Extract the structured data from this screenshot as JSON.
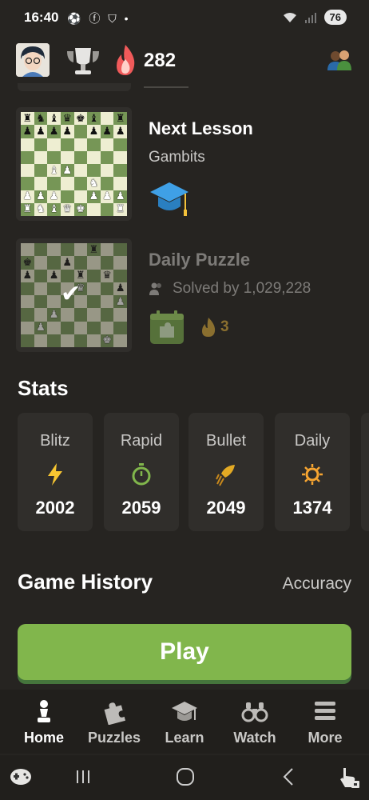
{
  "status_bar": {
    "time": "16:40",
    "icons": "⚽ ⓕ ⛉ •",
    "battery": "76"
  },
  "top_bar": {
    "streak_count": "282",
    "icons": [
      "avatar",
      "trophy-icon",
      "flame-icon",
      "friends-icon"
    ]
  },
  "lesson": {
    "title": "Next Lesson",
    "subtitle": "Gambits",
    "icon": "graduation-cap-icon"
  },
  "puzzle": {
    "title": "Daily Puzzle",
    "solved_text": "Solved by 1,029,228",
    "streak": "3",
    "icons": [
      "people-icon",
      "puzzle-calendar-icon",
      "flame-icon"
    ]
  },
  "stats": {
    "title": "Stats",
    "cards": [
      {
        "name": "Blitz",
        "value": "2002",
        "icon": "lightning-icon",
        "color": "#f7c631"
      },
      {
        "name": "Rapid",
        "value": "2059",
        "icon": "stopwatch-icon",
        "color": "#81b64c"
      },
      {
        "name": "Bullet",
        "value": "2049",
        "icon": "rocket-icon",
        "color": "#e3aa24"
      },
      {
        "name": "Daily",
        "value": "1374",
        "icon": "sun-icon",
        "color": "#f7a531"
      }
    ]
  },
  "game_history": {
    "title": "Game History",
    "accuracy_label": "Accuracy"
  },
  "play_button": {
    "label": "Play",
    "color": "#81b64c"
  },
  "bottom_nav": {
    "items": [
      {
        "label": "Home",
        "icon": "pawn-icon",
        "active": true
      },
      {
        "label": "Puzzles",
        "icon": "puzzle-piece-icon",
        "active": false
      },
      {
        "label": "Learn",
        "icon": "graduation-cap-icon",
        "active": false
      },
      {
        "label": "Watch",
        "icon": "binoculars-icon",
        "active": false
      },
      {
        "label": "More",
        "icon": "menu-icon",
        "active": false
      }
    ]
  },
  "colors": {
    "background": "#262421",
    "card": "#302e2b",
    "accent_green": "#81b64c",
    "board_light": "#eeeed2",
    "board_dark": "#769656"
  }
}
